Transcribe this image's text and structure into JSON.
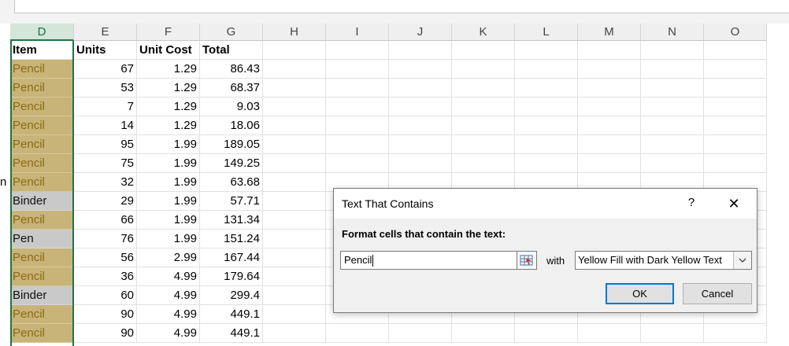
{
  "spreadsheet": {
    "columns": [
      "D",
      "E",
      "F",
      "G",
      "H",
      "I",
      "J",
      "K",
      "L",
      "M",
      "N",
      "O"
    ],
    "selected_column": "D",
    "headers": {
      "item": "Item",
      "units": "Units",
      "unit_cost": "Unit Cost",
      "total": "Total"
    },
    "cropped_cell_text": "n",
    "rows": [
      {
        "item": "Pencil",
        "units": "67",
        "unit_cost": "1.29",
        "total": "86.43",
        "highlight": "yellow"
      },
      {
        "item": "Pencil",
        "units": "53",
        "unit_cost": "1.29",
        "total": "68.37",
        "highlight": "yellow"
      },
      {
        "item": "Pencil",
        "units": "7",
        "unit_cost": "1.29",
        "total": "9.03",
        "highlight": "yellow"
      },
      {
        "item": "Pencil",
        "units": "14",
        "unit_cost": "1.29",
        "total": "18.06",
        "highlight": "yellow"
      },
      {
        "item": "Pencil",
        "units": "95",
        "unit_cost": "1.99",
        "total": "189.05",
        "highlight": "yellow"
      },
      {
        "item": "Pencil",
        "units": "75",
        "unit_cost": "1.99",
        "total": "149.25",
        "highlight": "yellow"
      },
      {
        "item": "Pencil",
        "units": "32",
        "unit_cost": "1.99",
        "total": "63.68",
        "highlight": "yellow"
      },
      {
        "item": "Binder",
        "units": "29",
        "unit_cost": "1.99",
        "total": "57.71",
        "highlight": "gray"
      },
      {
        "item": "Pencil",
        "units": "66",
        "unit_cost": "1.99",
        "total": "131.34",
        "highlight": "yellow"
      },
      {
        "item": "Pen",
        "units": "76",
        "unit_cost": "1.99",
        "total": "151.24",
        "highlight": "gray"
      },
      {
        "item": "Pencil",
        "units": "56",
        "unit_cost": "2.99",
        "total": "167.44",
        "highlight": "yellow"
      },
      {
        "item": "Pencil",
        "units": "36",
        "unit_cost": "4.99",
        "total": "179.64",
        "highlight": "yellow"
      },
      {
        "item": "Binder",
        "units": "60",
        "unit_cost": "4.99",
        "total": "299.4",
        "highlight": "gray"
      },
      {
        "item": "Pencil",
        "units": "90",
        "unit_cost": "4.99",
        "total": "449.1",
        "highlight": "yellow"
      },
      {
        "item": "Pencil",
        "units": "90",
        "unit_cost": "4.99",
        "total": "449.1",
        "highlight": "yellow"
      }
    ]
  },
  "dialog": {
    "title": "Text That Contains",
    "help_symbol": "?",
    "close_symbol": "✕",
    "label": "Format cells that contain the text:",
    "input_value": "Pencil",
    "with_label": "with",
    "format_selected": "Yellow Fill with Dark Yellow Text",
    "ok_label": "OK",
    "cancel_label": "Cancel",
    "range_icon": "range-select-icon",
    "dropdown_icon": "chevron-down-icon"
  },
  "colors": {
    "accent": "#217346",
    "highlight_fill": "#c8b479",
    "highlight_text": "#8a6a12",
    "duplicate_gray": "#c9c9c9",
    "ok_border": "#0078d7"
  }
}
